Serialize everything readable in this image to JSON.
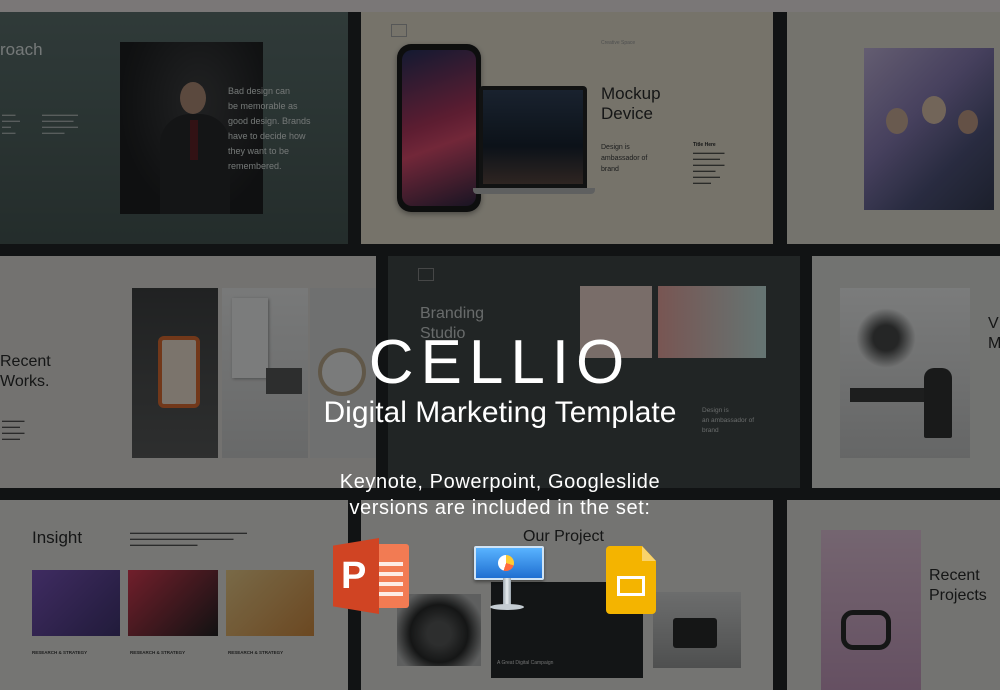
{
  "hero": {
    "title": "CELLIO",
    "subtitle": "Digital Marketing Template",
    "included_line1": "Keynote, Powerpoint, Googleslide",
    "included_line2": "versions are included in the set:"
  },
  "apps": [
    {
      "name": "Powerpoint",
      "icon": "powerpoint-icon",
      "color": "#d04423",
      "letter": "P"
    },
    {
      "name": "Keynote",
      "icon": "keynote-icon",
      "color": "#2f8de0"
    },
    {
      "name": "Google Slides",
      "icon": "google-slides-icon",
      "color": "#f4b400"
    }
  ],
  "slides": {
    "approach": {
      "title": "roach",
      "quote": [
        "Bad design can",
        "be memorable as",
        "good design. Brands",
        "have to decide how",
        "they want to be",
        "remembered."
      ]
    },
    "mockup": {
      "label": "Creative Space",
      "title_line1": "Mockup",
      "title_line2": "Device",
      "body": [
        "Design is",
        "ambassador of",
        "brand"
      ],
      "side_title": "Title Here"
    },
    "recent_works": {
      "line1": "Recent",
      "line2": "Works."
    },
    "branding": {
      "line1": "Branding",
      "line2": "Studio",
      "body": [
        "Design is",
        "an ambassador of",
        "brand"
      ]
    },
    "team": {
      "line1": "V",
      "line2": "M"
    },
    "insight": {
      "title": "Insight",
      "caption": "RESEARCH & STRATEGY"
    },
    "our_project": {
      "title": "Our Project",
      "caption": "A Great Digital Campaign"
    },
    "recent_projects": {
      "line1": "Recent",
      "line2": "Projects"
    }
  },
  "colors": {
    "approach_bg": "#4f6462",
    "mockup_bg": "#ede5d4",
    "branding_bg": "#3f4444",
    "powerpoint": "#d04423",
    "keynote": "#2f8de0",
    "google_slides": "#f4b400"
  }
}
